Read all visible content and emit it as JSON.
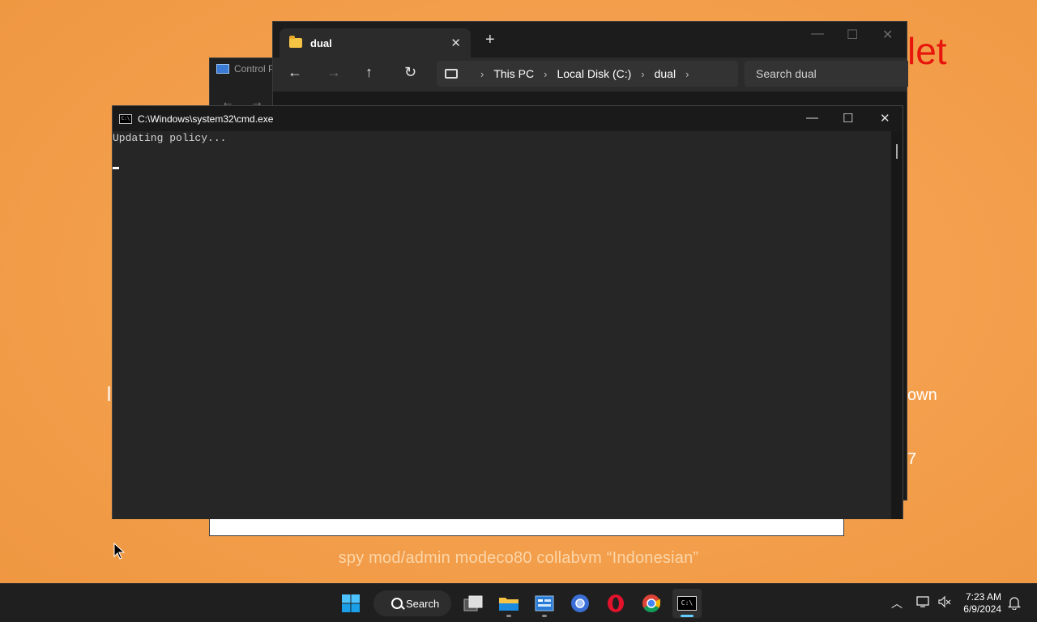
{
  "wallpaper": {
    "caption": "spy mod/admin modeco80 collabvm “Indonesian”",
    "red_text": "let",
    "text_own": "own",
    "text_7": "7"
  },
  "control_panel": {
    "title": "Control P",
    "icon": "control-panel-icon"
  },
  "explorer": {
    "tab_title": "dual",
    "tab_icon": "folder-icon",
    "new_tab": "+",
    "breadcrumb": [
      "This PC",
      "Local Disk (C:)",
      "dual"
    ],
    "search_placeholder": "Search dual",
    "nav_icons": [
      "back-arrow-icon",
      "forward-arrow-icon",
      "up-arrow-icon",
      "refresh-icon"
    ]
  },
  "cmd": {
    "title": "C:\\Windows\\system32\\cmd.exe",
    "icon_text": "C:\\",
    "lines": [
      "Updating policy..."
    ]
  },
  "taskbar": {
    "search_label": "Search",
    "apps": [
      "start-icon",
      "task-view-icon",
      "file-explorer-icon",
      "control-panel-icon",
      "chromium-icon",
      "opera-icon",
      "chrome-icon",
      "cmd-icon"
    ],
    "cmd_icon_text": "C:\\",
    "clock_time": "7:23 AM",
    "clock_date": "6/9/2024"
  },
  "colors": {
    "accent": "#60cdff",
    "wallpaper": "#f4a04e",
    "red_text": "#e7150c"
  }
}
